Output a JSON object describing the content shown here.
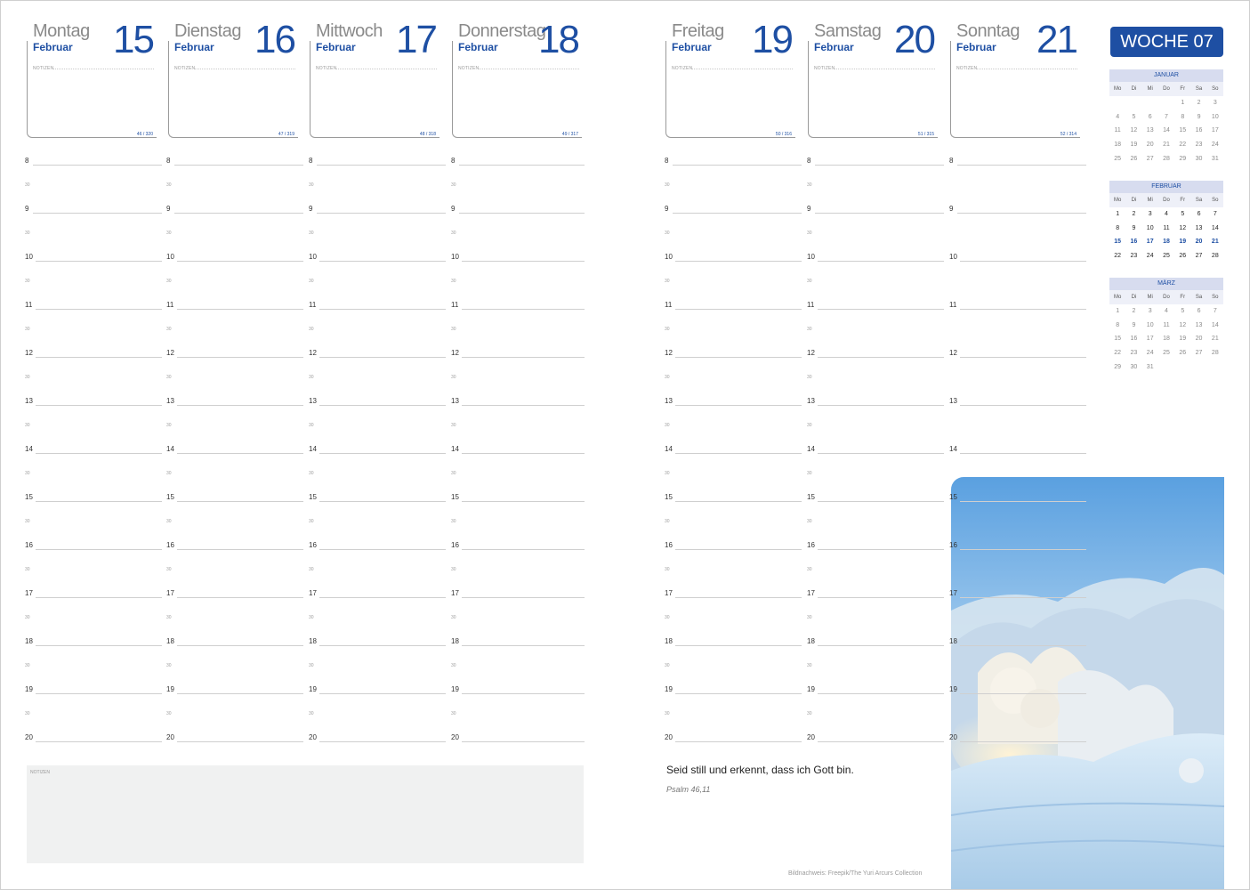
{
  "notes_label": "NOTIZEN",
  "days": [
    {
      "name": "Montag",
      "month": "Februar",
      "number": "15",
      "ratio": "46 / 320"
    },
    {
      "name": "Dienstag",
      "month": "Februar",
      "number": "16",
      "ratio": "47 / 319"
    },
    {
      "name": "Mittwoch",
      "month": "Februar",
      "number": "17",
      "ratio": "48 / 318"
    },
    {
      "name": "Donnerstag",
      "month": "Februar",
      "number": "18",
      "ratio": "49 / 317"
    },
    {
      "name": "Freitag",
      "month": "Februar",
      "number": "19",
      "ratio": "50 / 316"
    },
    {
      "name": "Samstag",
      "month": "Februar",
      "number": "20",
      "ratio": "51 / 315"
    },
    {
      "name": "Sonntag",
      "month": "Februar",
      "number": "21",
      "ratio": "52 / 314"
    }
  ],
  "weekday_slots": [
    "8",
    "30",
    "9",
    "30",
    "10",
    "30",
    "11",
    "30",
    "12",
    "30",
    "13",
    "30",
    "14",
    "30",
    "15",
    "30",
    "16",
    "30",
    "17",
    "30",
    "18",
    "30",
    "19",
    "30",
    "20"
  ],
  "sunday_slots": [
    "8",
    "9",
    "10",
    "11",
    "12",
    "13",
    "14",
    "15",
    "16",
    "17",
    "18",
    "19",
    "20"
  ],
  "week_label": "WOCHE 07",
  "weekday_abbr": [
    "Mo",
    "Di",
    "Mi",
    "Do",
    "Fr",
    "Sa",
    "So"
  ],
  "mini_calendars": [
    {
      "month": "JANUAR",
      "weeks": [
        [
          "",
          "",
          "",
          "",
          "1",
          "2",
          "3"
        ],
        [
          "4",
          "5",
          "6",
          "7",
          "8",
          "9",
          "10"
        ],
        [
          "11",
          "12",
          "13",
          "14",
          "15",
          "16",
          "17"
        ],
        [
          "18",
          "19",
          "20",
          "21",
          "22",
          "23",
          "24"
        ],
        [
          "25",
          "26",
          "27",
          "28",
          "29",
          "30",
          "31"
        ]
      ]
    },
    {
      "month": "FEBRUAR",
      "weeks": [
        [
          "1",
          "2",
          "3",
          "4",
          "5",
          "6",
          "7"
        ],
        [
          "8",
          "9",
          "10",
          "11",
          "12",
          "13",
          "14"
        ],
        [
          "15",
          "16",
          "17",
          "18",
          "19",
          "20",
          "21"
        ],
        [
          "22",
          "23",
          "24",
          "25",
          "26",
          "27",
          "28"
        ]
      ]
    },
    {
      "month": "MÄRZ",
      "weeks": [
        [
          "1",
          "2",
          "3",
          "4",
          "5",
          "6",
          "7"
        ],
        [
          "8",
          "9",
          "10",
          "11",
          "12",
          "13",
          "14"
        ],
        [
          "15",
          "16",
          "17",
          "18",
          "19",
          "20",
          "21"
        ],
        [
          "22",
          "23",
          "24",
          "25",
          "26",
          "27",
          "28"
        ],
        [
          "29",
          "30",
          "31",
          "",
          "",
          "",
          ""
        ]
      ]
    }
  ],
  "quote": "Seid still und erkennt, dass ich Gott bin.",
  "quote_source": "Psalm 46,11",
  "image_credit": "Bildnachweis: Freepik/The Yuri Arcurs Collection",
  "colors": {
    "accent": "#1e4fa3",
    "notes_bg": "#f0f1f1",
    "calendar_header": "#d7dcef"
  }
}
